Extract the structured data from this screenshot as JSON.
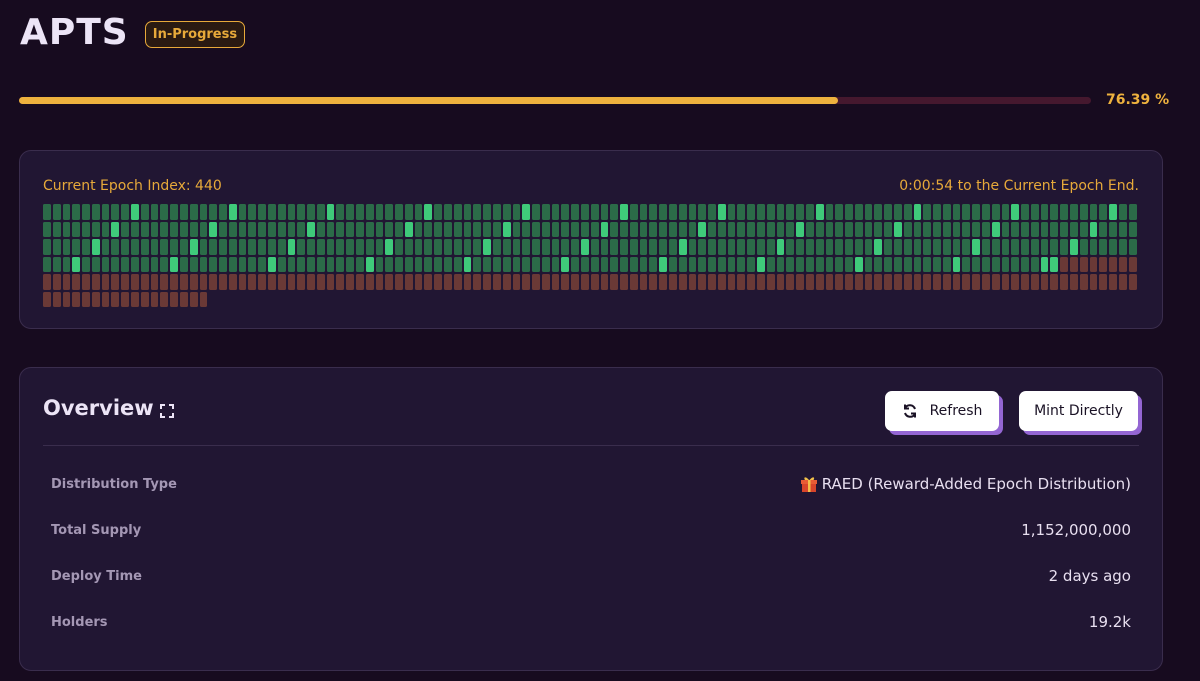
{
  "header": {
    "title": "APTS",
    "status": "In-Progress"
  },
  "progress": {
    "fraction": 0.7639,
    "label": "76.39 %"
  },
  "epoch": {
    "index_label": "Current Epoch Index: 440",
    "timer_label": "0:00:54 to the Current Epoch End.",
    "completed": 440,
    "pending": 137
  },
  "overview": {
    "title": "Overview",
    "refresh_label": "Refresh",
    "mint_label": "Mint Directly",
    "rows": [
      {
        "label": "Distribution Type",
        "value": "RAED (Reward-Added Epoch Distribution)"
      },
      {
        "label": "Total Supply",
        "value": "1,152,000,000"
      },
      {
        "label": "Deploy Time",
        "value": "2 days ago"
      },
      {
        "label": "Holders",
        "value": "19.2k"
      }
    ]
  },
  "colors": {
    "accent": "#eeb23e",
    "epoch_completed": "#2b6b48",
    "epoch_highlight": "#3fca7a",
    "epoch_pending": "#6a3936",
    "button_shadow": "#9466d3"
  },
  "icons": {
    "expand": "expand-icon",
    "refresh": "refresh-icon",
    "distribution": "gift-icon"
  }
}
